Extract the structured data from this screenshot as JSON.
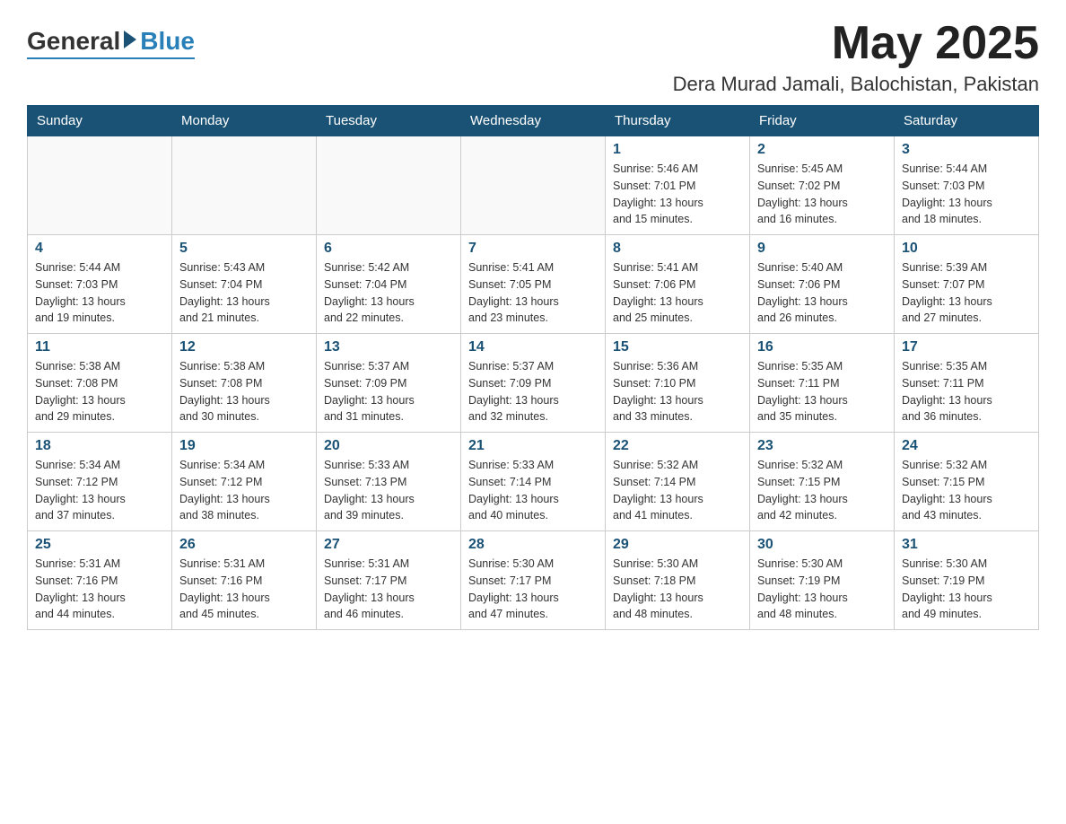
{
  "logo": {
    "general": "General",
    "blue": "Blue"
  },
  "header": {
    "month": "May 2025",
    "location": "Dera Murad Jamali, Balochistan, Pakistan"
  },
  "weekdays": [
    "Sunday",
    "Monday",
    "Tuesday",
    "Wednesday",
    "Thursday",
    "Friday",
    "Saturday"
  ],
  "weeks": [
    [
      {
        "day": "",
        "info": ""
      },
      {
        "day": "",
        "info": ""
      },
      {
        "day": "",
        "info": ""
      },
      {
        "day": "",
        "info": ""
      },
      {
        "day": "1",
        "info": "Sunrise: 5:46 AM\nSunset: 7:01 PM\nDaylight: 13 hours\nand 15 minutes."
      },
      {
        "day": "2",
        "info": "Sunrise: 5:45 AM\nSunset: 7:02 PM\nDaylight: 13 hours\nand 16 minutes."
      },
      {
        "day": "3",
        "info": "Sunrise: 5:44 AM\nSunset: 7:03 PM\nDaylight: 13 hours\nand 18 minutes."
      }
    ],
    [
      {
        "day": "4",
        "info": "Sunrise: 5:44 AM\nSunset: 7:03 PM\nDaylight: 13 hours\nand 19 minutes."
      },
      {
        "day": "5",
        "info": "Sunrise: 5:43 AM\nSunset: 7:04 PM\nDaylight: 13 hours\nand 21 minutes."
      },
      {
        "day": "6",
        "info": "Sunrise: 5:42 AM\nSunset: 7:04 PM\nDaylight: 13 hours\nand 22 minutes."
      },
      {
        "day": "7",
        "info": "Sunrise: 5:41 AM\nSunset: 7:05 PM\nDaylight: 13 hours\nand 23 minutes."
      },
      {
        "day": "8",
        "info": "Sunrise: 5:41 AM\nSunset: 7:06 PM\nDaylight: 13 hours\nand 25 minutes."
      },
      {
        "day": "9",
        "info": "Sunrise: 5:40 AM\nSunset: 7:06 PM\nDaylight: 13 hours\nand 26 minutes."
      },
      {
        "day": "10",
        "info": "Sunrise: 5:39 AM\nSunset: 7:07 PM\nDaylight: 13 hours\nand 27 minutes."
      }
    ],
    [
      {
        "day": "11",
        "info": "Sunrise: 5:38 AM\nSunset: 7:08 PM\nDaylight: 13 hours\nand 29 minutes."
      },
      {
        "day": "12",
        "info": "Sunrise: 5:38 AM\nSunset: 7:08 PM\nDaylight: 13 hours\nand 30 minutes."
      },
      {
        "day": "13",
        "info": "Sunrise: 5:37 AM\nSunset: 7:09 PM\nDaylight: 13 hours\nand 31 minutes."
      },
      {
        "day": "14",
        "info": "Sunrise: 5:37 AM\nSunset: 7:09 PM\nDaylight: 13 hours\nand 32 minutes."
      },
      {
        "day": "15",
        "info": "Sunrise: 5:36 AM\nSunset: 7:10 PM\nDaylight: 13 hours\nand 33 minutes."
      },
      {
        "day": "16",
        "info": "Sunrise: 5:35 AM\nSunset: 7:11 PM\nDaylight: 13 hours\nand 35 minutes."
      },
      {
        "day": "17",
        "info": "Sunrise: 5:35 AM\nSunset: 7:11 PM\nDaylight: 13 hours\nand 36 minutes."
      }
    ],
    [
      {
        "day": "18",
        "info": "Sunrise: 5:34 AM\nSunset: 7:12 PM\nDaylight: 13 hours\nand 37 minutes."
      },
      {
        "day": "19",
        "info": "Sunrise: 5:34 AM\nSunset: 7:12 PM\nDaylight: 13 hours\nand 38 minutes."
      },
      {
        "day": "20",
        "info": "Sunrise: 5:33 AM\nSunset: 7:13 PM\nDaylight: 13 hours\nand 39 minutes."
      },
      {
        "day": "21",
        "info": "Sunrise: 5:33 AM\nSunset: 7:14 PM\nDaylight: 13 hours\nand 40 minutes."
      },
      {
        "day": "22",
        "info": "Sunrise: 5:32 AM\nSunset: 7:14 PM\nDaylight: 13 hours\nand 41 minutes."
      },
      {
        "day": "23",
        "info": "Sunrise: 5:32 AM\nSunset: 7:15 PM\nDaylight: 13 hours\nand 42 minutes."
      },
      {
        "day": "24",
        "info": "Sunrise: 5:32 AM\nSunset: 7:15 PM\nDaylight: 13 hours\nand 43 minutes."
      }
    ],
    [
      {
        "day": "25",
        "info": "Sunrise: 5:31 AM\nSunset: 7:16 PM\nDaylight: 13 hours\nand 44 minutes."
      },
      {
        "day": "26",
        "info": "Sunrise: 5:31 AM\nSunset: 7:16 PM\nDaylight: 13 hours\nand 45 minutes."
      },
      {
        "day": "27",
        "info": "Sunrise: 5:31 AM\nSunset: 7:17 PM\nDaylight: 13 hours\nand 46 minutes."
      },
      {
        "day": "28",
        "info": "Sunrise: 5:30 AM\nSunset: 7:17 PM\nDaylight: 13 hours\nand 47 minutes."
      },
      {
        "day": "29",
        "info": "Sunrise: 5:30 AM\nSunset: 7:18 PM\nDaylight: 13 hours\nand 48 minutes."
      },
      {
        "day": "30",
        "info": "Sunrise: 5:30 AM\nSunset: 7:19 PM\nDaylight: 13 hours\nand 48 minutes."
      },
      {
        "day": "31",
        "info": "Sunrise: 5:30 AM\nSunset: 7:19 PM\nDaylight: 13 hours\nand 49 minutes."
      }
    ]
  ]
}
